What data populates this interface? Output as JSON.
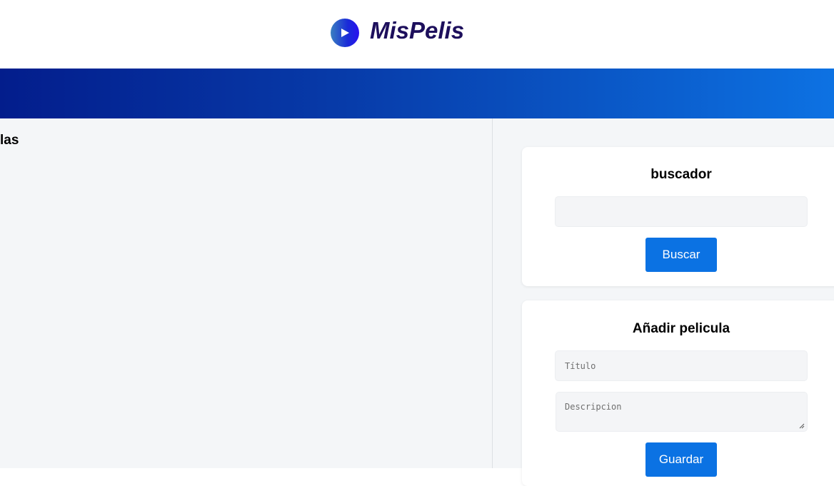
{
  "header": {
    "logo_icon": "play-icon",
    "logo_text": "MisPelis"
  },
  "left_panel": {
    "title_partial": "las"
  },
  "search_card": {
    "title": "buscador",
    "input_value": "",
    "button_label": "Buscar"
  },
  "add_card": {
    "title": "Añadir pelicula",
    "title_placeholder": "Título",
    "description_placeholder": "Descripcion",
    "button_label": "Guardar"
  },
  "colors": {
    "accent": "#0b72e3",
    "banner_start": "#031d8c",
    "banner_end": "#0d72e3",
    "logo_text": "#1d0f5c"
  }
}
